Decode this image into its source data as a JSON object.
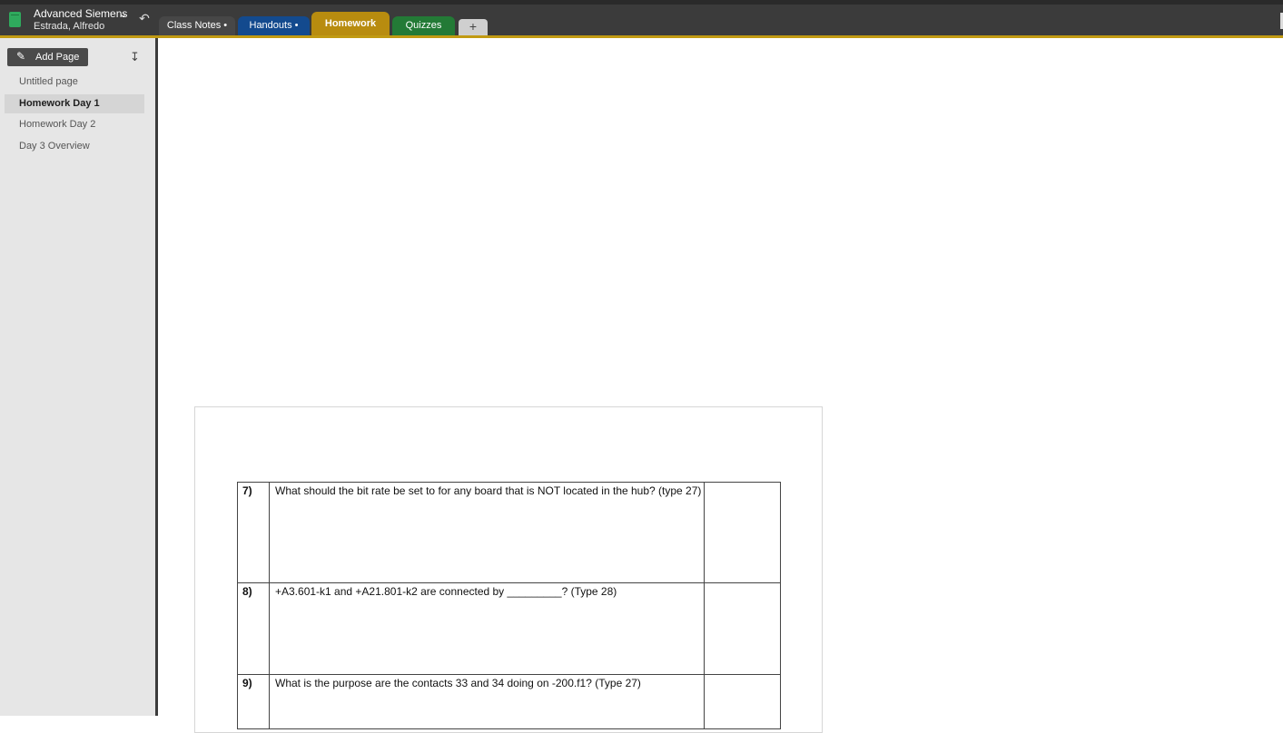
{
  "notebook": {
    "title": "Advanced Siemens",
    "owner": "Estrada, Alfredo",
    "icon": "notebook-icon",
    "accent": "#c19a12"
  },
  "toolbar": {
    "undo_icon": "undo-icon"
  },
  "tabs": [
    {
      "label": "Class Notes •",
      "color": "#474747"
    },
    {
      "label": "Handouts •",
      "color": "#134a8e"
    },
    {
      "label": "Homework",
      "color": "#b88c0f",
      "active": true
    },
    {
      "label": "Quizzes",
      "color": "#237a36"
    },
    {
      "label": "+",
      "color": "#cfcfcf"
    }
  ],
  "sidebar": {
    "add_page_label": "Add Page",
    "sort_icon": "sort-icon",
    "pages": [
      {
        "label": "Untitled page",
        "active": false
      },
      {
        "label": "Homework Day 1",
        "active": true
      },
      {
        "label": "Homework Day 2",
        "active": false
      },
      {
        "label": "Day 3 Overview",
        "active": false
      }
    ]
  },
  "worksheet": {
    "rows": [
      {
        "num": "7)",
        "question": "What should the bit rate be set to for any board that is NOT located in the hub? (type 27)",
        "answer": ""
      },
      {
        "num": "8)",
        "question": "+A3.601-k1 and +A21.801-k2 are connected by _________? (Type 28)",
        "answer": ""
      },
      {
        "num": "9)",
        "question": "What is the purpose are the contacts 33 and 34 doing on -200.f1? (Type 27)",
        "answer": ""
      }
    ]
  }
}
